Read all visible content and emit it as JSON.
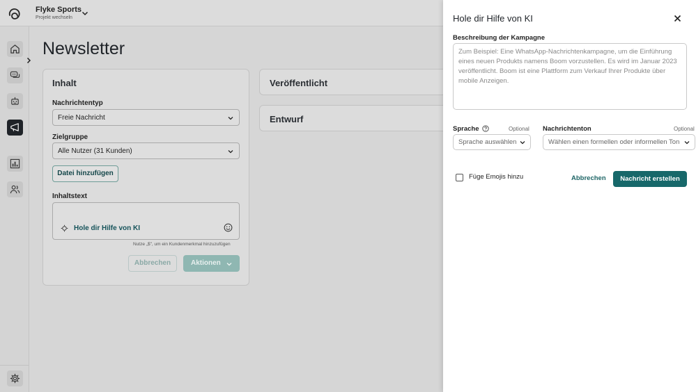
{
  "topbar": {
    "project_name": "Flyke Sports",
    "project_sub": "Projekt wechseln"
  },
  "sidebar": {
    "items": [
      {
        "name": "home",
        "icon": "home-icon"
      },
      {
        "name": "chat",
        "icon": "chat-bubbles-icon"
      },
      {
        "name": "bot",
        "icon": "robot-icon"
      },
      {
        "name": "newsletter",
        "icon": "megaphone-icon",
        "active": true
      },
      {
        "name": "analytics",
        "icon": "bar-chart-icon"
      },
      {
        "name": "users",
        "icon": "users-icon"
      }
    ],
    "settings_icon": "gear-icon"
  },
  "main": {
    "title": "Newsletter",
    "content_card": {
      "title": "Inhalt",
      "message_type_label": "Nachrichtentyp",
      "message_type_value": "Freie Nachricht",
      "audience_label": "Zielgruppe",
      "audience_value": "Alle Nutzer (31 Kunden)",
      "add_file_label": "Datei hinzufügen",
      "content_text_label": "Inhaltstext",
      "ai_help_label": "Hole dir Hilfe von KI",
      "hint": "Nutze „$\", um ein Kundenmerkmal hinzuzufügen",
      "cancel_label": "Abbrechen",
      "actions_label": "Aktionen"
    },
    "published_card": {
      "title": "Veröffentlicht"
    },
    "draft_card": {
      "title": "Entwurf"
    }
  },
  "panel": {
    "title": "Hole dir Hilfe von KI",
    "description_label": "Beschreibung der Kampagne",
    "description_placeholder": "Zum Beispiel: Eine WhatsApp-Nachrichtenkampagne, um die Einführung eines neuen Produkts namens Boom vorzustellen. Es wird im Januar 2023 veröffentlicht. Boom ist eine Plattform zum Verkauf Ihrer Produkte über mobile Anzeigen.",
    "language_label": "Sprache",
    "language_optional": "Optional",
    "language_placeholder": "Sprache auswählen",
    "tone_label": "Nachrichtenton",
    "tone_optional": "Optional",
    "tone_placeholder": "Wählen einen formellen oder informellen Ton",
    "emoji_label": "Füge Emojis hinzu",
    "cancel_label": "Abbrechen",
    "create_label": "Nachricht erstellen"
  },
  "colors": {
    "accent": "#17686a",
    "accent_link": "#1e6566",
    "active_nav": "#1f2328"
  }
}
